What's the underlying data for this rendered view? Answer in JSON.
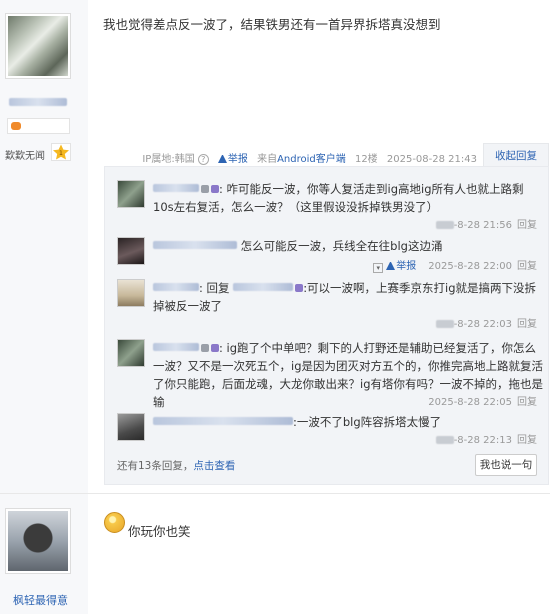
{
  "post1": {
    "text": "我也觉得差点反一波了，结果铁男还有一首异界拆塔真没想到",
    "user": {
      "rank_title": "歎歎无闻",
      "rank_level": "1"
    },
    "meta": {
      "ip_label": "IP属地:韩国",
      "help_icon": "?",
      "report_label": "举报",
      "source_prefix": "来自",
      "source_client": "Android客户端",
      "floor": "12楼",
      "datetime": "2025-08-28 21:43",
      "fold_reply_label": "收起回复"
    },
    "replies": [
      {
        "text": ": 咋可能反一波，你等人复活走到ig高地ig所有人也就上路剩10s左右复活，怎么一波？（这里假设没拆掉铁男没了）",
        "date_suffix": "-8-28 21:56",
        "reply_label": "回复"
      },
      {
        "text": "怎么可能反一波，兵线全在往blg这边涌",
        "report_label": "举报",
        "datetime": "2025-8-28 22:00",
        "reply_label": "回复"
      },
      {
        "prefix": ": 回复",
        "text": ":可以一波啊，上赛季京东打ig就是搞两下没拆掉被反一波了",
        "date_suffix": "-8-28 22:03",
        "reply_label": "回复"
      },
      {
        "text": ": ig跑了个中单吧？剩下的人打野还是辅助已经复活了，你怎么一波？又不是一次死五个，ig是因为团灭对方五个的，你推完高地上路就复活了你只能跑，后面龙魂，大龙你敢出来？ig有塔你有吗？一波不掉的，拖也是输",
        "datetime": "2025-8-28 22:05",
        "reply_label": "回复"
      },
      {
        "text": ":一波不了blg阵容拆塔太慢了",
        "date_suffix": "-8-28 22:13",
        "reply_label": "回复"
      }
    ],
    "more": {
      "prefix": "还有13条回复，",
      "link": "点击查看"
    },
    "say_button": "我也说一句"
  },
  "post2": {
    "text": "你玩你也笑",
    "user": {
      "name": "枫轻最得意"
    }
  }
}
